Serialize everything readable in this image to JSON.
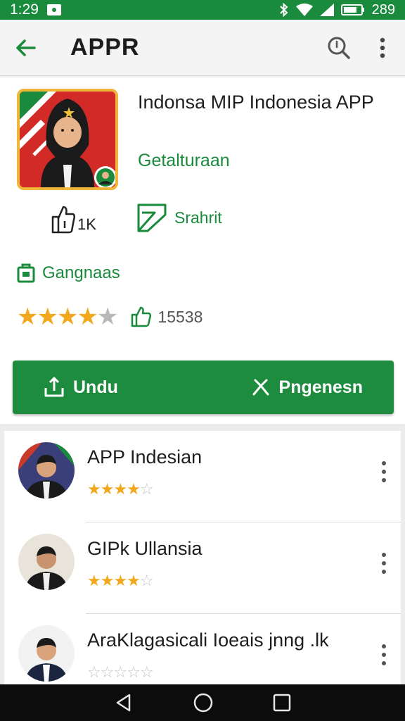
{
  "status_bar": {
    "time": "1:29",
    "battery": "289"
  },
  "app_bar": {
    "title": "APPR"
  },
  "app": {
    "name": "Indonsa MIP Indonesia APP",
    "developer": "Getalturaan",
    "stat_downloads": "1K",
    "stat_label": "Srahrit",
    "category": "Gangnaas",
    "rating_stars": 4,
    "rating_count": "15538"
  },
  "actions": {
    "install_label": "Undu",
    "share_label": "Pngenesn"
  },
  "list": [
    {
      "name": "APP Indesian",
      "stars": 4
    },
    {
      "name": "GIPk Ullansia",
      "stars": 4
    },
    {
      "name": "AraKlagasicali Ioeais jnng .lk",
      "stars": 0
    }
  ],
  "colors": {
    "brand_green": "#1a8a3c",
    "star": "#f2a81d",
    "icon_border": "#f0b63a"
  }
}
